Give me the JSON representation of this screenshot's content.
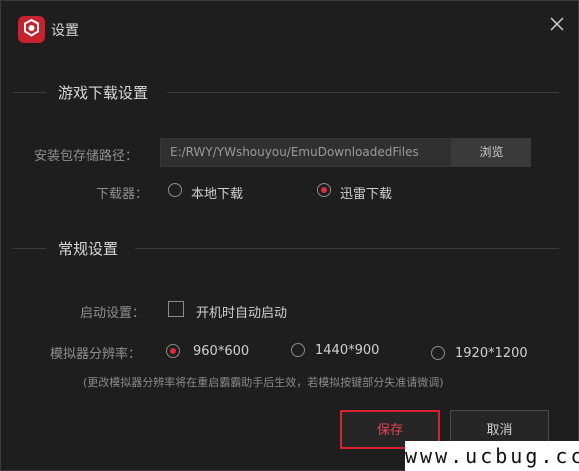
{
  "window": {
    "title": "设置"
  },
  "sections": {
    "download": {
      "title": "游戏下载设置"
    },
    "general": {
      "title": "常规设置"
    }
  },
  "download": {
    "path_label": "安装包存储路径：",
    "path_value": "E:/RWY/YWshouyou/EmuDownloadedFiles",
    "browse_label": "浏览",
    "downloader_label": "下载器：",
    "options": [
      {
        "label": "本地下载",
        "checked": false
      },
      {
        "label": "迅雷下载",
        "checked": true
      }
    ]
  },
  "general": {
    "startup_label": "启动设置：",
    "autostart_label": "开机时自动启动",
    "autostart_checked": false,
    "resolution_label": "模拟器分辨率：",
    "resolutions": [
      {
        "label": "960*600",
        "checked": true
      },
      {
        "label": "1440*900",
        "checked": false
      },
      {
        "label": "1920*1200",
        "checked": false
      }
    ],
    "note": "(更改模拟器分辨率将在重启霸霸助手后生效，若模拟按键部分失准请微调)"
  },
  "buttons": {
    "save": "保存",
    "cancel": "取消"
  },
  "watermark": "www.ucbug.cc",
  "colors": {
    "accent": "#d8232f",
    "background": "#1e1e1e"
  }
}
